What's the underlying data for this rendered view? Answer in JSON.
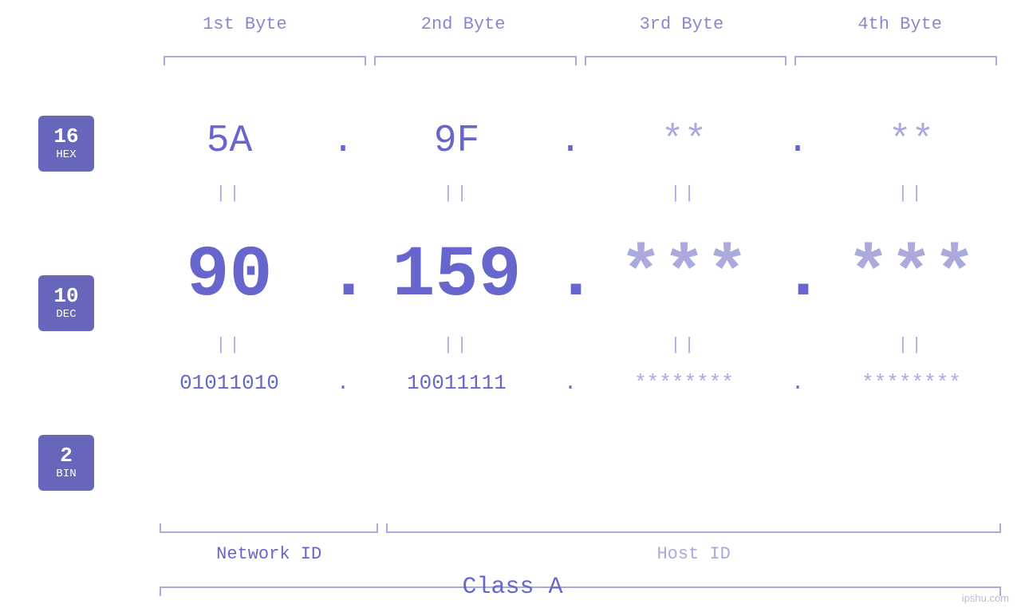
{
  "headers": {
    "byte1": "1st Byte",
    "byte2": "2nd Byte",
    "byte3": "3rd Byte",
    "byte4": "4th Byte"
  },
  "badges": [
    {
      "number": "16",
      "label": "HEX"
    },
    {
      "number": "10",
      "label": "DEC"
    },
    {
      "number": "2",
      "label": "BIN"
    }
  ],
  "hex": {
    "b1": "5A",
    "b2": "9F",
    "b3": "**",
    "b4": "**",
    "dot": "."
  },
  "dec": {
    "b1": "90",
    "b2": "159",
    "b3": "***",
    "b4": "***",
    "dot": "."
  },
  "bin": {
    "b1": "01011010",
    "b2": "10011111",
    "b3": "********",
    "b4": "********",
    "dot": "."
  },
  "labels": {
    "network_id": "Network ID",
    "host_id": "Host ID",
    "class": "Class A"
  },
  "watermark": "ipshu.com",
  "equals": "||"
}
